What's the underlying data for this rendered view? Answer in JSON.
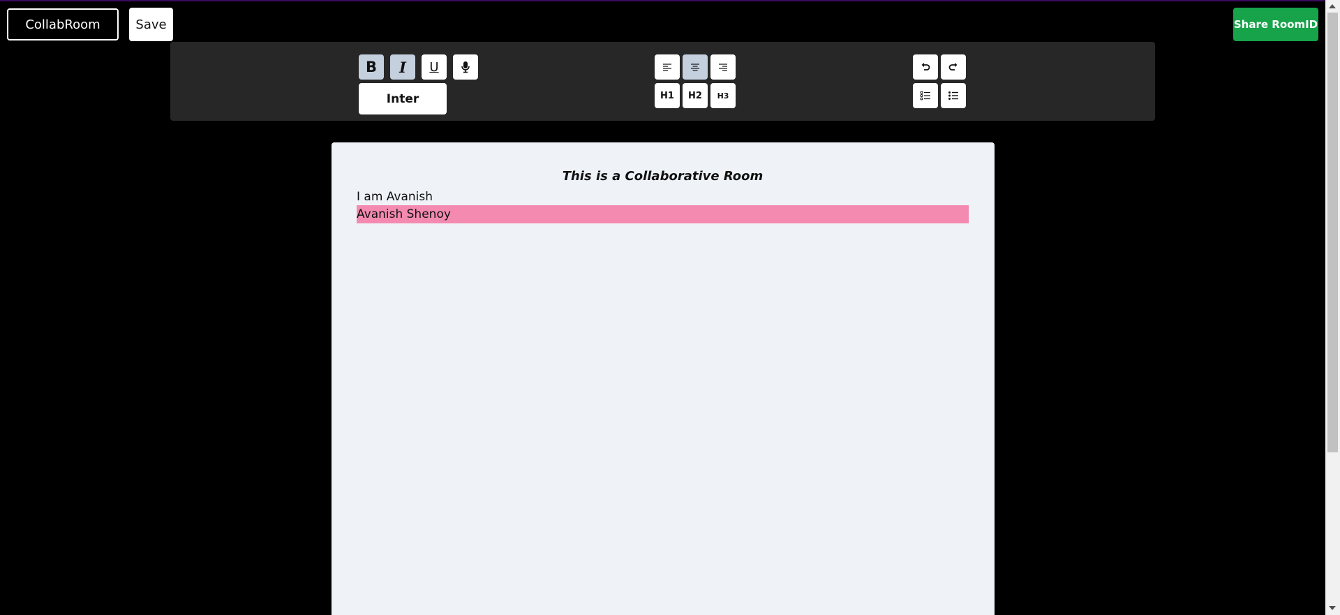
{
  "header": {
    "brand_label": "CollabRoom",
    "save_label": "Save",
    "share_label": "Share RoomID"
  },
  "toolbar": {
    "bold_glyph": "B",
    "italic_glyph": "I",
    "underline_glyph": "U",
    "mic_icon": "microphone-icon",
    "font_family_value": "Inter",
    "align_buttons": [
      "align-left-icon",
      "align-center-icon",
      "align-right-icon"
    ],
    "align_active": "align-center-icon",
    "heading_labels": [
      "H1",
      "H2",
      "H3"
    ],
    "history_buttons": [
      "undo-icon",
      "redo-icon"
    ],
    "list_buttons": [
      "ordered-list-icon",
      "bullet-list-icon"
    ],
    "active_marks": [
      "bold",
      "italic"
    ]
  },
  "editor": {
    "title": "This is a Collaborative Room",
    "line1": "I am Avanish",
    "highlighted_line": "Avanish Shenoy",
    "highlight_color": "#f48aaf"
  },
  "colors": {
    "background": "#000000",
    "toolbar": "#272727",
    "editor": "#eff3f8",
    "share_button": "#16a34a",
    "active_button": "#c5d0df"
  }
}
